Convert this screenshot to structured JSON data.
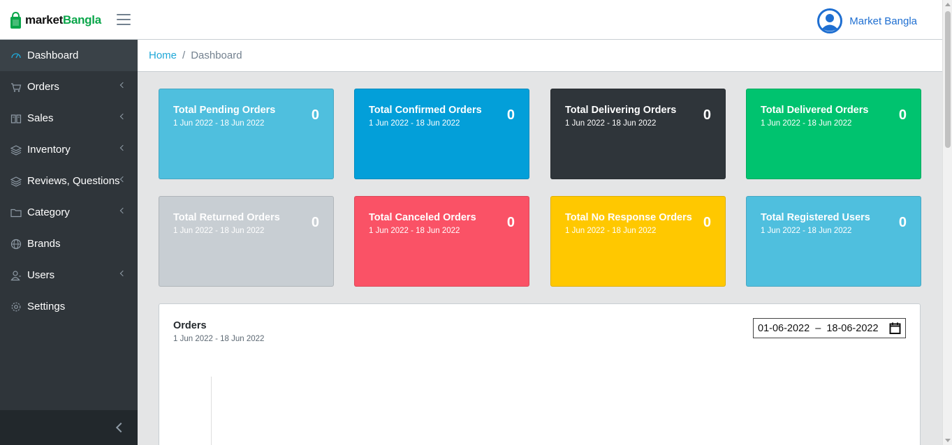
{
  "brand": {
    "part1": "market",
    "part2": "Bangla"
  },
  "user": {
    "name": "Market Bangla"
  },
  "breadcrumb": {
    "home": "Home",
    "separator": "/",
    "current": "Dashboard"
  },
  "sidebar": {
    "items": [
      {
        "label": "Dashboard",
        "icon": "speedometer-icon",
        "active": true,
        "has_children": false
      },
      {
        "label": "Orders",
        "icon": "cart-icon",
        "active": false,
        "has_children": true
      },
      {
        "label": "Sales",
        "icon": "book-icon",
        "active": false,
        "has_children": true
      },
      {
        "label": "Inventory",
        "icon": "layers-icon",
        "active": false,
        "has_children": true
      },
      {
        "label": "Reviews, Questions",
        "icon": "layers-icon",
        "active": false,
        "has_children": true
      },
      {
        "label": "Category",
        "icon": "folder-icon",
        "active": false,
        "has_children": true
      },
      {
        "label": "Brands",
        "icon": "globe-icon",
        "active": false,
        "has_children": false
      },
      {
        "label": "Users",
        "icon": "user-icon",
        "active": false,
        "has_children": true
      },
      {
        "label": "Settings",
        "icon": "gear-icon",
        "active": false,
        "has_children": false
      }
    ]
  },
  "cards": [
    {
      "title": "Total Pending Orders",
      "range": "1 Jun 2022 - 18 Jun 2022",
      "count": "0",
      "color": "#4fbfde"
    },
    {
      "title": "Total Confirmed Orders",
      "range": "1 Jun 2022 - 18 Jun 2022",
      "count": "0",
      "color": "#039fd9"
    },
    {
      "title": "Total Delivering Orders",
      "range": "1 Jun 2022 - 18 Jun 2022",
      "count": "0",
      "color": "#2f353a"
    },
    {
      "title": "Total Delivered Orders",
      "range": "1 Jun 2022 - 18 Jun 2022",
      "count": "0",
      "color": "#00c36f"
    },
    {
      "title": "Total Returned Orders",
      "range": "1 Jun 2022 - 18 Jun 2022",
      "count": "0",
      "color": "#c8ced3"
    },
    {
      "title": "Total Canceled Orders",
      "range": "1 Jun 2022 - 18 Jun 2022",
      "count": "0",
      "color": "#fa5266"
    },
    {
      "title": "Total No Response Orders",
      "range": "1 Jun 2022 - 18 Jun 2022",
      "count": "0",
      "color": "#ffc800"
    },
    {
      "title": "Total Registered Users",
      "range": "1 Jun 2022 - 18 Jun 2022",
      "count": "0",
      "color": "#4fbfde"
    }
  ],
  "orders_panel": {
    "title": "Orders",
    "range": "1 Jun 2022 - 18 Jun 2022",
    "date_input": "01-06-2022  –  18-06-2022"
  }
}
